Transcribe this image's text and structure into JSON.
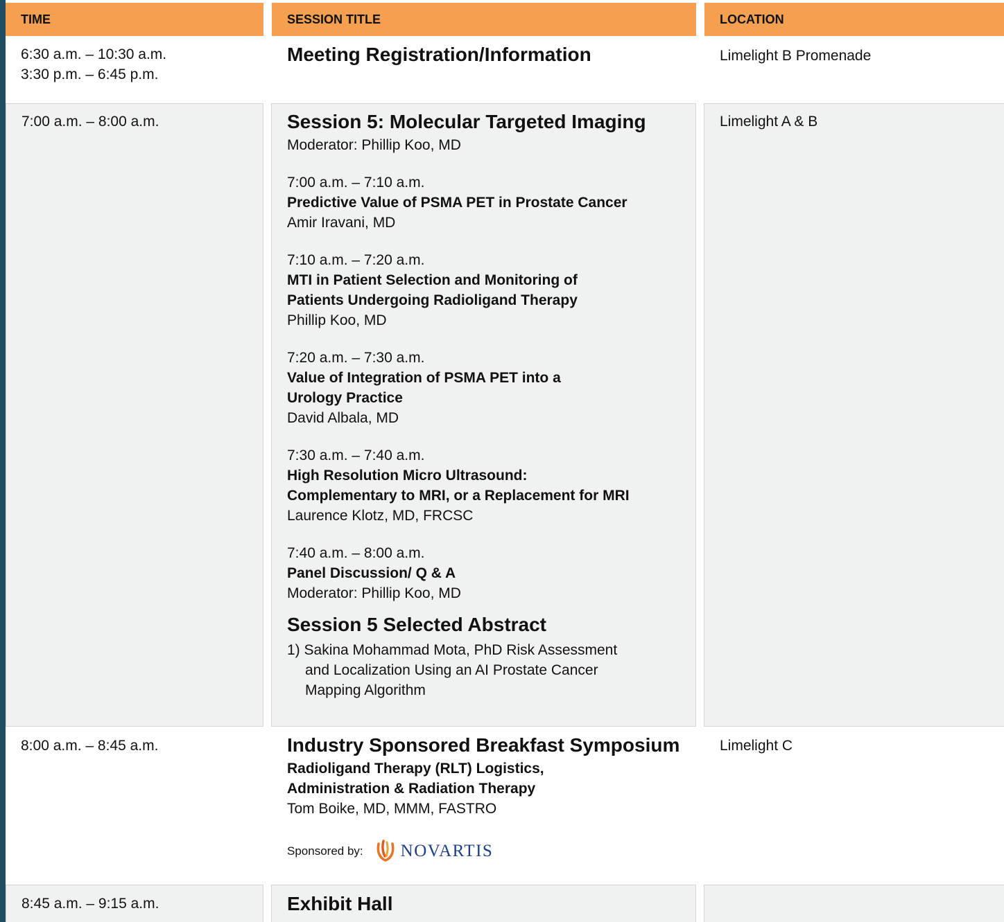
{
  "header": {
    "time": "TIME",
    "session_title": "SESSION TITLE",
    "location": "LOCATION"
  },
  "colors": {
    "header_bg": "#f4a050",
    "gray_cell": "#f0f1f1",
    "frame": "#1f4e63"
  },
  "rows": [
    {
      "time_lines": [
        "6:30 a.m. – 10:30 a.m.",
        "3:30 p.m. – 6:45 p.m."
      ],
      "title": "Meeting Registration/Information",
      "location": "Limelight B Promenade"
    },
    {
      "time": "7:00 a.m. – 8:00 a.m.",
      "title": "Session 5: Molecular Targeted Imaging",
      "moderator": "Moderator: Phillip Koo, MD",
      "talks": [
        {
          "time": "7:00 a.m. – 7:10 a.m.",
          "title_lines": [
            "Predictive Value of PSMA PET in Prostate Cancer"
          ],
          "speaker": "Amir Iravani, MD"
        },
        {
          "time": "7:10 a.m. – 7:20 a.m.",
          "title_lines": [
            "MTI in Patient Selection and Monitoring of",
            "Patients Undergoing Radioligand Therapy"
          ],
          "speaker": "Phillip Koo, MD"
        },
        {
          "time": "7:20 a.m. – 7:30 a.m.",
          "title_lines": [
            "Value of Integration of PSMA PET into a",
            "Urology Practice"
          ],
          "speaker": "David Albala, MD"
        },
        {
          "time": "7:30 a.m. – 7:40 a.m.",
          "title_lines": [
            "High Resolution Micro Ultrasound:",
            "Complementary to MRI, or a Replacement for MRI"
          ],
          "speaker": "Laurence Klotz, MD, FRCSC"
        },
        {
          "time": "7:40 a.m. – 8:00 a.m.",
          "title_lines": [
            "Panel Discussion/ Q & A"
          ],
          "speaker": "Moderator: Phillip Koo, MD"
        }
      ],
      "abstract_heading": "Session 5 Selected Abstract",
      "abstract_lines": [
        "1) Sakina Mohammad Mota, PhD Risk Assessment",
        "and Localization Using an AI Prostate Cancer",
        "Mapping Algorithm"
      ],
      "location": "Limelight A & B"
    },
    {
      "time": "8:00 a.m. – 8:45 a.m.",
      "title": "Industry Sponsored Breakfast Symposium",
      "subtitle_lines": [
        "Radioligand Therapy (RLT) Logistics,",
        "Administration & Radiation Therapy"
      ],
      "speaker": "Tom Boike, MD, MMM, FASTRO",
      "sponsor_label": "Sponsored by:",
      "sponsor_logo_text": "NOVARTIS",
      "location": "Limelight C"
    },
    {
      "time": "8:45 a.m. – 9:15 a.m.",
      "title": "Exhibit Hall"
    }
  ]
}
